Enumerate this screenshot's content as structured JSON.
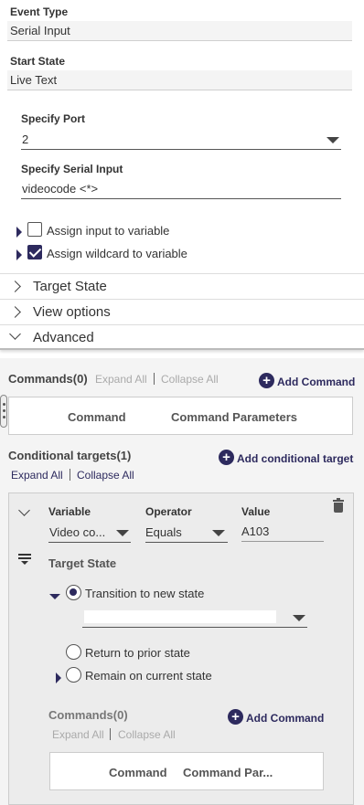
{
  "event": {
    "event_type_label": "Event Type",
    "event_type_value": "Serial Input",
    "start_state_label": "Start State",
    "start_state_value": "Live Text",
    "port_label": "Specify Port",
    "port_value": "2",
    "serial_input_label": "Specify Serial Input",
    "serial_input_value": "videocode <*>",
    "assign_input_label": "Assign input to variable",
    "assign_input_checked": false,
    "assign_wildcard_label": "Assign wildcard to variable",
    "assign_wildcard_checked": true
  },
  "sections": {
    "target_state": "Target State",
    "view_options": "View options",
    "advanced": "Advanced"
  },
  "commands": {
    "title": "Commands(0)",
    "expand_all": "Expand All",
    "collapse_all": "Collapse All",
    "add_command": "Add Command",
    "col_command": "Command",
    "col_params": "Command Parameters"
  },
  "conditional": {
    "title": "Conditional targets(1)",
    "expand_all": "Expand All",
    "collapse_all": "Collapse All",
    "add_target": "Add conditional target",
    "variable_label": "Variable",
    "variable_value": "Video co...",
    "operator_label": "Operator",
    "operator_value": "Equals",
    "value_label": "Value",
    "value_value": "A103",
    "target_state_label": "Target State",
    "transition_label": "Transition to new state",
    "return_label": "Return to prior state",
    "remain_label": "Remain on current state",
    "inner_commands_title": "Commands(0)",
    "inner_expand_all": "Expand All",
    "inner_collapse_all": "Collapse All",
    "inner_add_command": "Add Command",
    "inner_col_command": "Command",
    "inner_col_params": "Command Par..."
  },
  "colors": {
    "accent": "#2d2a5e",
    "panel_bg": "#f4f4f4"
  }
}
